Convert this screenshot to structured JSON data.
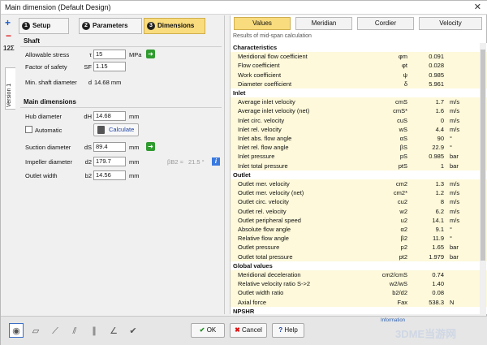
{
  "window": {
    "title": "Main dimension (Default Design)",
    "close": "✕"
  },
  "leftbar": {
    "plus": "+",
    "minus": "−",
    "sigma": "12Σ",
    "version": "Version 1"
  },
  "steps": [
    {
      "num": "1",
      "label": "Setup"
    },
    {
      "num": "2",
      "label": "Parameters"
    },
    {
      "num": "3",
      "label": "Dimensions"
    }
  ],
  "shaft": {
    "title": "Shaft",
    "rows": [
      {
        "label": "Allowable stress",
        "sym": "τ",
        "value": "15",
        "unit": "MPa"
      },
      {
        "label": "Factor of safety",
        "sym": "SF",
        "value": "1.15",
        "unit": ""
      }
    ],
    "min_label": "Min. shaft diameter",
    "min_sym": "d",
    "min_value": "14.68 mm"
  },
  "main": {
    "title": "Main dimensions",
    "hub_label": "Hub diameter",
    "hub_sym": "dH",
    "hub_value": "14.68",
    "hub_unit": "mm",
    "automatic": "Automatic",
    "calculate": "Calculate",
    "suction_label": "Suction diameter",
    "suction_sym": "dS",
    "suction_value": "89.4",
    "suction_unit": "mm",
    "impeller_label": "Impeller diameter",
    "impeller_sym": "d2",
    "impeller_value": "179.7",
    "impeller_unit": "mm",
    "beta": "βB2 ≈",
    "beta_val": "21.5 °",
    "outlet_label": "Outlet width",
    "outlet_sym": "b2",
    "outlet_value": "14.56",
    "outlet_unit": "mm"
  },
  "tabs": [
    "Values",
    "Meridian",
    "Cordier",
    "Velocity"
  ],
  "caption": "Results of mid-span calculation",
  "table": [
    {
      "h": "Characteristics"
    },
    {
      "n": "Meridional flow coefficient",
      "s": "φm",
      "v": "0.091",
      "u": ""
    },
    {
      "n": "Flow coefficient",
      "s": "φt",
      "v": "0.028",
      "u": ""
    },
    {
      "n": "Work coefficient",
      "s": "ψ",
      "v": "0.985",
      "u": ""
    },
    {
      "n": "Diameter coefficient",
      "s": "δ",
      "v": "5.961",
      "u": ""
    },
    {
      "h": "Inlet"
    },
    {
      "n": "Average inlet velocity",
      "s": "cmS",
      "v": "1.7",
      "u": "m/s"
    },
    {
      "n": "Average inlet velocity (net)",
      "s": "cmS*",
      "v": "1.6",
      "u": "m/s"
    },
    {
      "n": "Inlet circ. velocity",
      "s": "cuS",
      "v": "0",
      "u": "m/s"
    },
    {
      "n": "Inlet rel. velocity",
      "s": "wS",
      "v": "4.4",
      "u": "m/s"
    },
    {
      "n": "Inlet abs. flow angle",
      "s": "αS",
      "v": "90",
      "u": "°"
    },
    {
      "n": "Inlet rel. flow angle",
      "s": "βS",
      "v": "22.9",
      "u": "°"
    },
    {
      "n": "Inlet pressure",
      "s": "pS",
      "v": "0.985",
      "u": "bar"
    },
    {
      "n": "Inlet total pressure",
      "s": "ptS",
      "v": "1",
      "u": "bar"
    },
    {
      "h": "Outlet"
    },
    {
      "n": "Outlet mer. velocity",
      "s": "cm2",
      "v": "1.3",
      "u": "m/s"
    },
    {
      "n": "Outlet mer. velocity (net)",
      "s": "cm2*",
      "v": "1.2",
      "u": "m/s"
    },
    {
      "n": "Outlet circ. velocity",
      "s": "cu2",
      "v": "8",
      "u": "m/s"
    },
    {
      "n": "Outlet rel. velocity",
      "s": "w2",
      "v": "6.2",
      "u": "m/s"
    },
    {
      "n": "Outlet peripheral speed",
      "s": "u2",
      "v": "14.1",
      "u": "m/s"
    },
    {
      "n": "Absolute flow angle",
      "s": "α2",
      "v": "9.1",
      "u": "°"
    },
    {
      "n": "Relative flow angle",
      "s": "β2",
      "v": "11.9",
      "u": "°"
    },
    {
      "n": "Outlet pressure",
      "s": "p2",
      "v": "1.65",
      "u": "bar"
    },
    {
      "n": "Outlet total pressure",
      "s": "pt2",
      "v": "1.979",
      "u": "bar"
    },
    {
      "h": "Global values"
    },
    {
      "n": "Meridional deceleration",
      "s": "cm2/cmS",
      "v": "0.74",
      "u": ""
    },
    {
      "n": "Relative velocity ratio S->2",
      "s": "w2/wS",
      "v": "1.40",
      "u": ""
    },
    {
      "n": "Outlet width ratio",
      "s": "b2/d2",
      "v": "0.08",
      "u": ""
    },
    {
      "n": "Axial force",
      "s": "Fax",
      "v": "538.3",
      "u": "N"
    },
    {
      "h": "NPSHR"
    }
  ],
  "buttons": {
    "ok": "OK",
    "cancel": "Cancel",
    "help": "Help"
  },
  "info_label": "Information",
  "watermark": "3DME当游网"
}
